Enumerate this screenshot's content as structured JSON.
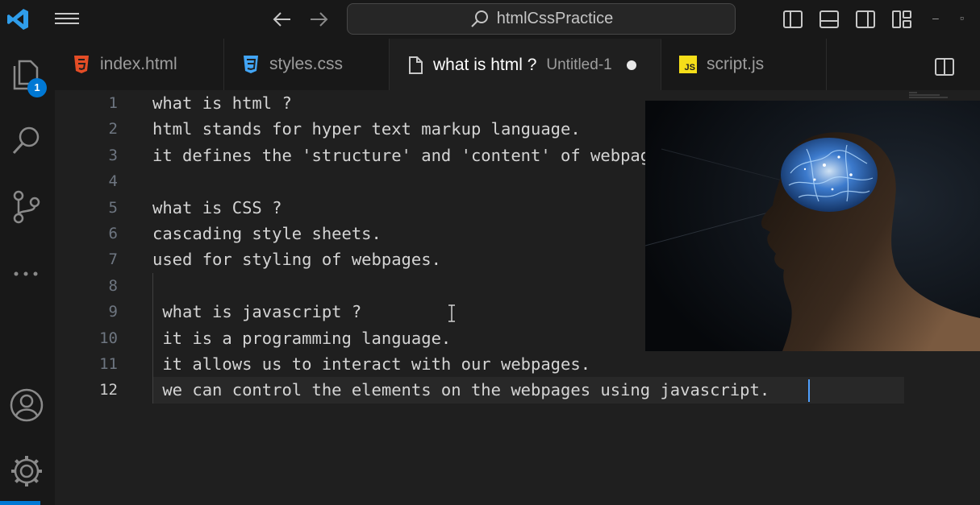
{
  "titlebar": {
    "search_label": "htmlCssPractice"
  },
  "activity": {
    "explorer_badge": "1"
  },
  "tabs": [
    {
      "label": "index.html",
      "icon": "html5-icon"
    },
    {
      "label": "styles.css",
      "icon": "css3-icon"
    },
    {
      "label": "what is html ?",
      "sub": "Untitled-1",
      "icon": "file-icon",
      "modified": true
    },
    {
      "label": "script.js",
      "icon": "js-icon",
      "badge": "JS"
    }
  ],
  "editor": {
    "current_line": 12,
    "lines": [
      {
        "num": "1",
        "text": "what is html ?"
      },
      {
        "num": "2",
        "text": "html stands for hyper text markup language."
      },
      {
        "num": "3",
        "text": "it defines the 'structure' and 'content' of webpages."
      },
      {
        "num": "4",
        "text": ""
      },
      {
        "num": "5",
        "text": "what is CSS ?"
      },
      {
        "num": "6",
        "text": "cascading style sheets."
      },
      {
        "num": "7",
        "text": "used for styling of webpages."
      },
      {
        "num": "8",
        "text": ""
      },
      {
        "num": "9",
        "text": " what is javascript ?"
      },
      {
        "num": "10",
        "text": " it is a programming language."
      },
      {
        "num": "11",
        "text": " it allows us to interact with our webpages."
      },
      {
        "num": "12",
        "text": " we can control the elements on the webpages using javascript."
      }
    ]
  },
  "colors": {
    "accent": "#0078d4",
    "html_icon": "#e44d26",
    "css_icon": "#42a5f5",
    "js_icon": "#f5de19"
  }
}
